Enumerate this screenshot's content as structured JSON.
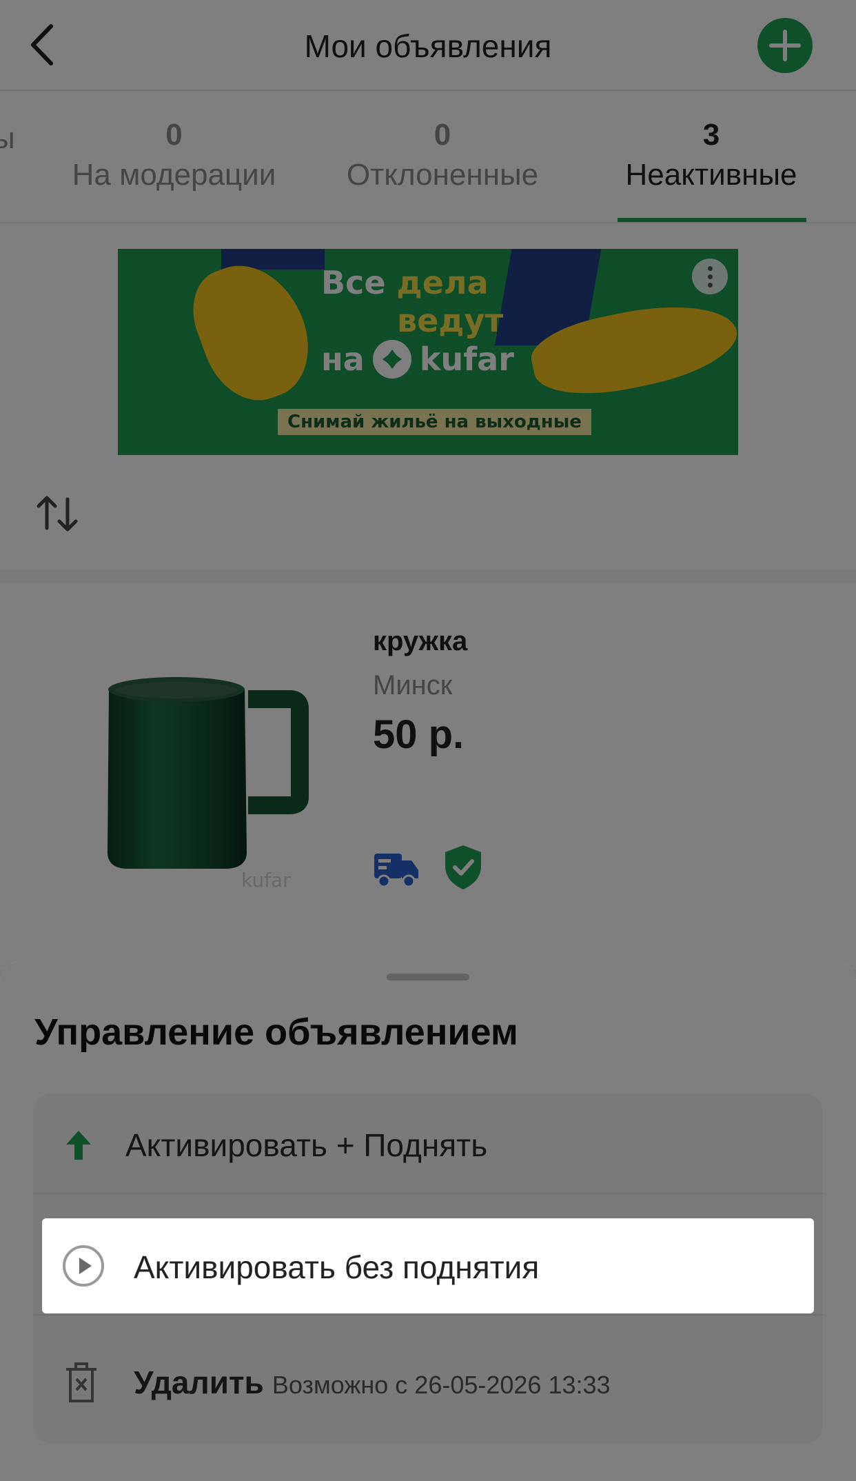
{
  "header": {
    "title": "Мои объявления"
  },
  "tabs": [
    {
      "count": "",
      "label": "ы"
    },
    {
      "count": "0",
      "label": "На модерации"
    },
    {
      "count": "0",
      "label": "Отклоненные"
    },
    {
      "count": "3",
      "label": "Неактивные",
      "active": true
    }
  ],
  "banner": {
    "line1": "Все",
    "line1_accent": "дела",
    "line2": "ведут",
    "line3": "на",
    "brand": "kufar",
    "cta": "Снимай жильё на выходные"
  },
  "listing": {
    "title": "кружка",
    "city": "Минск",
    "price": "50 р.",
    "watermark": "kufar"
  },
  "sheet": {
    "title": "Управление объявлением",
    "options": {
      "activate_boost": "Активировать + Поднять",
      "activate_no_boost": "Активировать без поднятия",
      "delete_label": "Удалить",
      "delete_note": "Возможно с 26-05-2026 13:33"
    }
  },
  "colors": {
    "brand_green": "#1e9e54",
    "active_underline": "#1e9e54",
    "overlay": "rgba(0,0,0,0.5)"
  },
  "icons": [
    "chevron-left-icon",
    "plus-icon",
    "sort-icon",
    "delivery-truck-icon",
    "verified-shield-icon",
    "boost-arrow-icon",
    "play-circle-icon",
    "trash-icon",
    "more-vertical-icon"
  ]
}
